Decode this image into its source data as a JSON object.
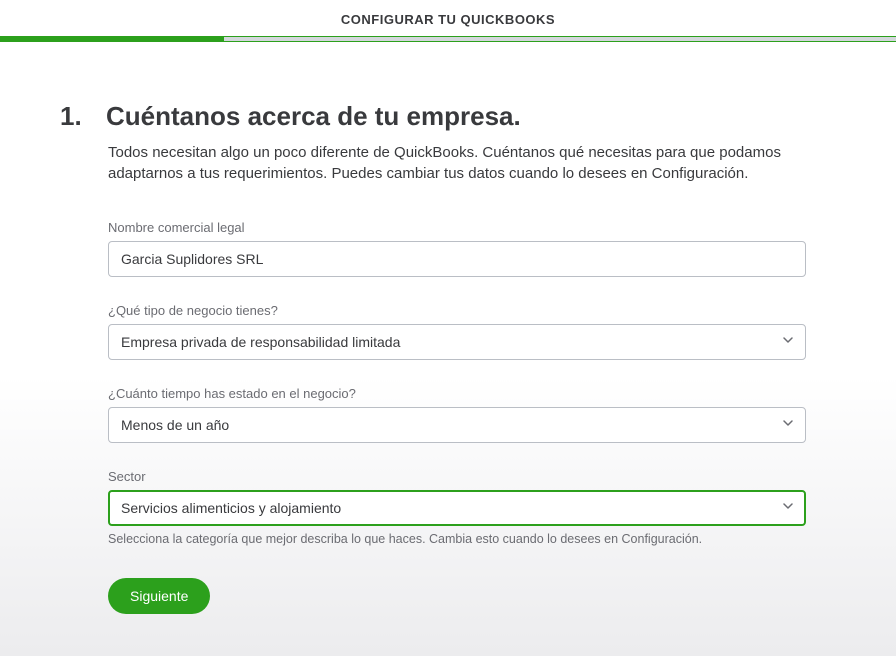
{
  "header": {
    "title": "CONFIGURAR TU QUICKBOOKS"
  },
  "progress": {
    "percent": 25
  },
  "step": {
    "number": "1.",
    "title": "Cuéntanos acerca de tu empresa.",
    "subtitle": "Todos necesitan algo un poco diferente de QuickBooks. Cuéntanos qué necesitas para que podamos adaptarnos a tus requerimientos. Puedes cambiar tus datos cuando lo desees en Configuración."
  },
  "fields": {
    "legal_name": {
      "label": "Nombre comercial legal",
      "value": "Garcia Suplidores SRL"
    },
    "business_type": {
      "label": "¿Qué tipo de negocio tienes?",
      "value": "Empresa privada de responsabilidad limitada"
    },
    "time_in_business": {
      "label": "¿Cuánto tiempo has estado en el negocio?",
      "value": "Menos de un año"
    },
    "sector": {
      "label": "Sector",
      "value": "Servicios alimenticios y alojamiento",
      "helper": "Selecciona la categoría que mejor describa lo que haces. Cambia esto cuando lo desees en Configuración."
    }
  },
  "buttons": {
    "next": "Siguiente"
  }
}
